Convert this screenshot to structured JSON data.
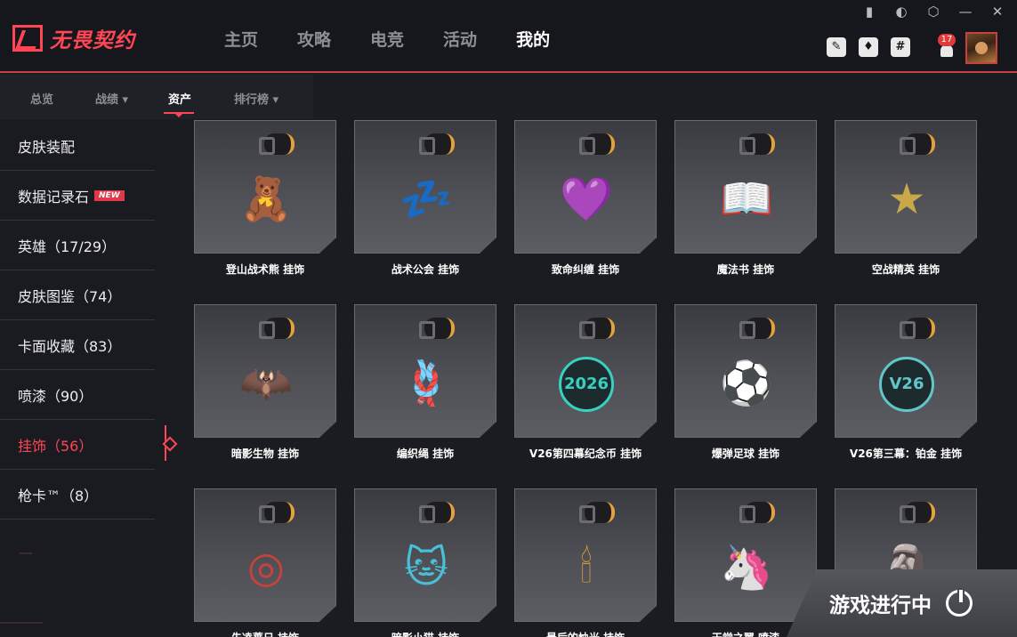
{
  "app": {
    "title": "无畏契约"
  },
  "main_nav": [
    "主页",
    "攻略",
    "电竞",
    "活动",
    "我的"
  ],
  "main_nav_active": "我的",
  "window_controls": [
    "▮",
    "◐",
    "⬡",
    "—",
    "✕"
  ],
  "top_icons": [
    {
      "name": "mail-icon",
      "glyph": "✎"
    },
    {
      "name": "team-icon",
      "glyph": "♦"
    },
    {
      "name": "chat-icon",
      "glyph": "#"
    }
  ],
  "notifications": {
    "count": "17"
  },
  "sub_nav": {
    "items": [
      "总览",
      "战绩 ▾",
      "资产",
      "排行榜 ▾"
    ],
    "active": "资产"
  },
  "sidebar": {
    "items": [
      {
        "label": "皮肤装配",
        "badge": ""
      },
      {
        "label": "数据记录石",
        "badge": "NEW"
      },
      {
        "label": "英雄（17/29）",
        "badge": ""
      },
      {
        "label": "皮肤图鉴（74）",
        "badge": ""
      },
      {
        "label": "卡面收藏（83）",
        "badge": ""
      },
      {
        "label": "喷漆（90）",
        "badge": ""
      },
      {
        "label": "挂饰（56）",
        "badge": ""
      },
      {
        "label": "枪卡™（8）",
        "badge": ""
      }
    ],
    "active_index": 6
  },
  "grid": {
    "cards": [
      {
        "label": "登山战术熊 挂饰",
        "icon": "🧸",
        "color": "#8a4a32"
      },
      {
        "label": "战术公会 挂饰",
        "icon": "💤",
        "color": "#6e8a3a"
      },
      {
        "label": "致命纠缠 挂饰",
        "icon": "💜",
        "color": "#8e3ac9"
      },
      {
        "label": "魔法书 挂饰",
        "icon": "📖",
        "color": "#b08a3a"
      },
      {
        "label": "空战精英 挂饰",
        "icon": "★",
        "color": "#c9a84a"
      },
      {
        "label": "暗影生物 挂饰",
        "icon": "🦇",
        "color": "#3a2a44"
      },
      {
        "label": "编织绳 挂饰",
        "icon": "🪢",
        "color": "#6e4a8a"
      },
      {
        "label": "V26第四幕纪念币 挂饰",
        "icon": "2026",
        "color": "#3ad0c0"
      },
      {
        "label": "爆弹足球 挂饰",
        "icon": "⚽",
        "color": "#d8d8d0"
      },
      {
        "label": "V26第三幕：铂金 挂饰",
        "icon": "V26",
        "color": "#62c6c9"
      },
      {
        "label": "先凌蔷日 挂饰",
        "icon": "◎",
        "color": "#c9413c"
      },
      {
        "label": "暗影小猫 挂饰",
        "icon": "🐱",
        "color": "#48c0d8"
      },
      {
        "label": "最后的烛光 挂饰",
        "icon": "🕯",
        "color": "#e3a23a"
      },
      {
        "label": "天堂之翼 喷漆",
        "icon": "🦄",
        "color": "#6e8a7a"
      },
      {
        "label": "",
        "icon": "🗿",
        "color": "#6a5048"
      }
    ]
  },
  "status": {
    "running_label": "游戏进行中"
  }
}
